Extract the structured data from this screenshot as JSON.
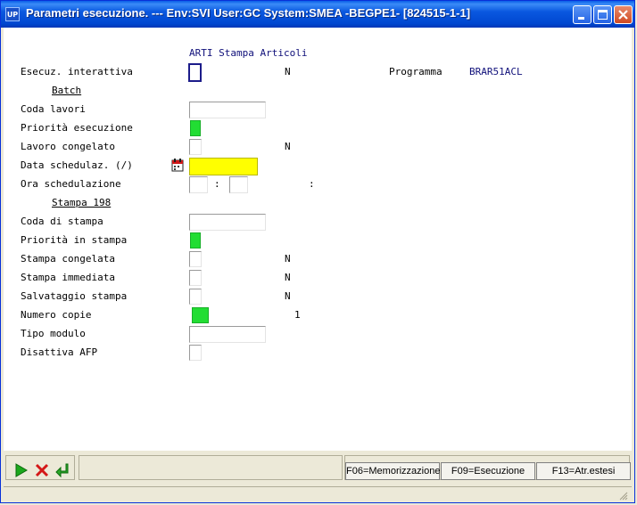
{
  "window": {
    "title": "Parametri esecuzione. --- Env:SVI User:GC System:SMEA -BEGPE1- [824515-1-1]",
    "icon_text": "UP"
  },
  "header": {
    "heading": "ARTI Stampa Articoli"
  },
  "fields": {
    "esecuz_interattiva": {
      "label": "Esecuz. interattiva",
      "value": "N"
    },
    "programma": {
      "label": "Programma",
      "value": "BRAR51ACL"
    },
    "batch_section": "Batch",
    "coda_lavori": {
      "label": "Coda lavori",
      "value": ""
    },
    "priorita_esecuzione": {
      "label": "Priorità esecuzione"
    },
    "lavoro_congelato": {
      "label": "Lavoro congelato",
      "value": "N"
    },
    "data_schedulaz": {
      "label": "Data schedulaz. (/)",
      "value": ""
    },
    "ora_schedulazione": {
      "label": "Ora  schedulazione",
      "separator": ":",
      "trailing": ":"
    },
    "stampa_section": "Stampa 198",
    "coda_di_stampa": {
      "label": "Coda di stampa",
      "value": ""
    },
    "priorita_in_stampa": {
      "label": "Priorità in stampa"
    },
    "stampa_congelata": {
      "label": "Stampa congelata",
      "value": "N"
    },
    "stampa_immediata": {
      "label": "Stampa immediata",
      "value": "N"
    },
    "salvataggio_stampa": {
      "label": "Salvataggio stampa",
      "value": "N"
    },
    "numero_copie": {
      "label": "Numero copie",
      "value": "1"
    },
    "tipo_modulo": {
      "label": "Tipo modulo",
      "value": ""
    },
    "disattiva_afp": {
      "label": "Disattiva AFP"
    }
  },
  "footer": {
    "f06": "F06=Memorizzazione",
    "f09": "F09=Esecuzione",
    "f13": "F13=Atr.estesi"
  },
  "icons": {
    "confirm": "play-icon",
    "cancel": "x-icon",
    "back": "return-arrow-icon",
    "calendar": "calendar-icon"
  },
  "colors": {
    "green_field": "#22dd33",
    "yellow_field": "#ffff00",
    "heading_blue": "#10107a",
    "titlebar_blue": "#0a58e0"
  }
}
